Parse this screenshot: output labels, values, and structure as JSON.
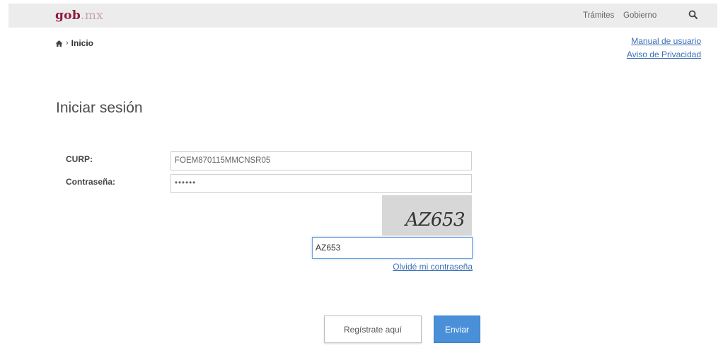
{
  "navbar": {
    "brand_main": "gob",
    "brand_tld": ".mx",
    "links": [
      "Trámites",
      "Gobierno"
    ],
    "search_icon": "search-icon"
  },
  "breadcrumb": {
    "home_icon": "home-icon",
    "separator": "›",
    "current": "Inicio"
  },
  "top_links": {
    "manual": "Manual de usuario",
    "privacy": "Aviso de Privacidad"
  },
  "title": "Iniciar sesión",
  "form": {
    "curp_label": "CURP:",
    "curp_value": "FOEM870115MMCNSR05",
    "password_label": "Contraseña:",
    "password_value": "••••••",
    "captcha_image_text": "AZ653",
    "captcha_value": "AZ653",
    "forgot_link": "Olvidé mi contraseña"
  },
  "buttons": {
    "register": "Regístrate aquí",
    "submit": "Enviar"
  },
  "colors": {
    "brand": "#8d1c3c",
    "link": "#3b6fb6",
    "primary_button": "#4a90d9"
  }
}
